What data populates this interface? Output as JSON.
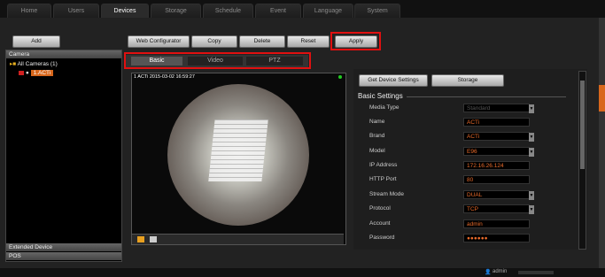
{
  "nav": {
    "tabs": [
      {
        "label": "Home"
      },
      {
        "label": "Users"
      },
      {
        "label": "Devices"
      },
      {
        "label": "Storage"
      },
      {
        "label": "Schedule"
      },
      {
        "label": "Event"
      },
      {
        "label": "Language"
      },
      {
        "label": "System"
      }
    ],
    "active": "Devices"
  },
  "left": {
    "add_label": "Add",
    "camera_title": "Camera",
    "all_cameras": "All Cameras (1)",
    "camera_item": "1.ACTi",
    "extended_device": "Extended Device",
    "pos": "POS"
  },
  "toolbar": {
    "web_configurator": "Web Configurator",
    "copy": "Copy",
    "delete": "Delete",
    "reset": "Reset",
    "apply": "Apply"
  },
  "subtabs": {
    "basic": "Basic",
    "video": "Video",
    "ptz": "PTZ"
  },
  "video": {
    "overlay": "1 ACTi  2015-03-02 16:59:27"
  },
  "settings": {
    "get_device_settings": "Get Device Settings",
    "storage": "Storage",
    "section_title": "Basic Settings",
    "fields": [
      {
        "label": "Media Type",
        "value": "Standard"
      },
      {
        "label": "Name",
        "value": "ACTi"
      },
      {
        "label": "Brand",
        "value": "ACTi"
      },
      {
        "label": "Model",
        "value": "E96"
      },
      {
        "label": "IP Address",
        "value": "172.16.26.124"
      },
      {
        "label": "HTTP Port",
        "value": "80"
      },
      {
        "label": "Stream Mode",
        "value": "DUAL"
      },
      {
        "label": "Protocol",
        "value": "TCP"
      },
      {
        "label": "Account",
        "value": "admin"
      },
      {
        "label": "Password",
        "value": "●●●●●●"
      }
    ]
  },
  "status": {
    "user": "admin"
  },
  "colors": {
    "highlight_red": "#e01010",
    "value_orange": "#e86a2a"
  }
}
